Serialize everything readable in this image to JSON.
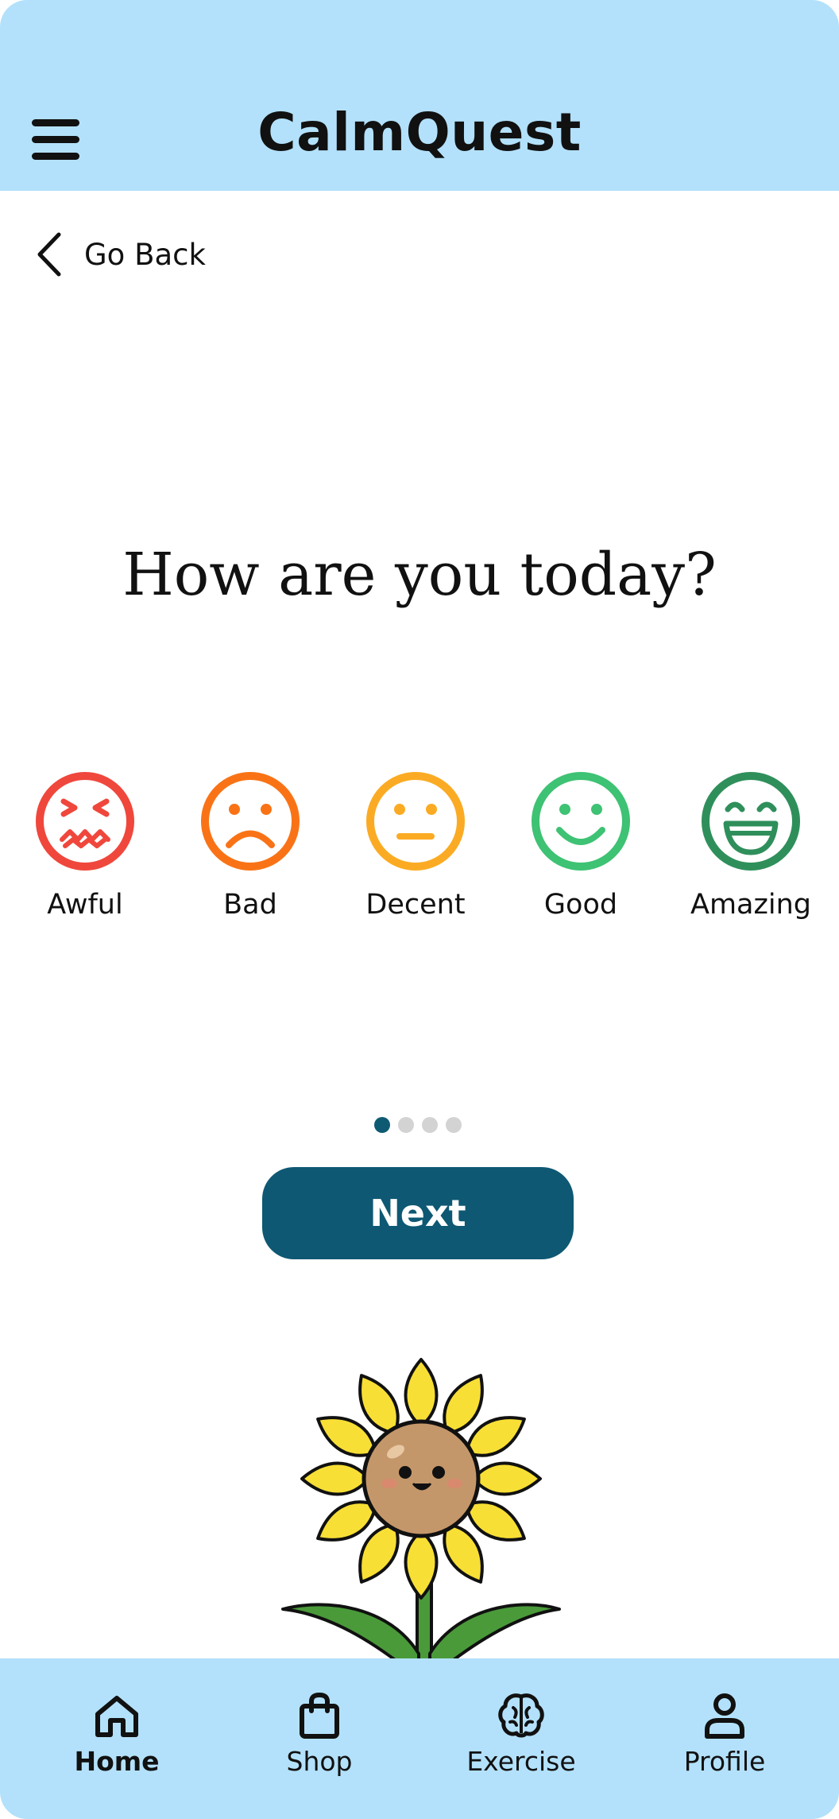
{
  "app": {
    "title": "CalmQuest"
  },
  "header": {
    "menu_icon": "hamburger-menu-icon"
  },
  "nav": {
    "back_label": "Go Back",
    "back_icon": "chevron-left-icon"
  },
  "question": "How are you today?",
  "moods": [
    {
      "label": "Awful",
      "icon": "face-awful-icon",
      "color": "#f0473c"
    },
    {
      "label": "Bad",
      "icon": "face-sad-icon",
      "color": "#f97316"
    },
    {
      "label": "Decent",
      "icon": "face-neutral-icon",
      "color": "#fbab23"
    },
    {
      "label": "Good",
      "icon": "face-smile-icon",
      "color": "#3ec273"
    },
    {
      "label": "Amazing",
      "icon": "face-grin-icon",
      "color": "#2f8f5b"
    }
  ],
  "pager": {
    "total": 4,
    "current": 1
  },
  "next_button": {
    "label": "Next"
  },
  "mascot": {
    "icon": "sunflower-mascot"
  },
  "tabs": [
    {
      "label": "Home",
      "icon": "home-icon",
      "active": true
    },
    {
      "label": "Shop",
      "icon": "shopping-bag-icon",
      "active": false
    },
    {
      "label": "Exercise",
      "icon": "brain-icon",
      "active": false
    },
    {
      "label": "Profile",
      "icon": "user-icon",
      "active": false
    }
  ],
  "colors": {
    "header_bg": "#b3e1fb",
    "primary": "#0e5873",
    "dot_inactive": "#d3d3d3"
  }
}
